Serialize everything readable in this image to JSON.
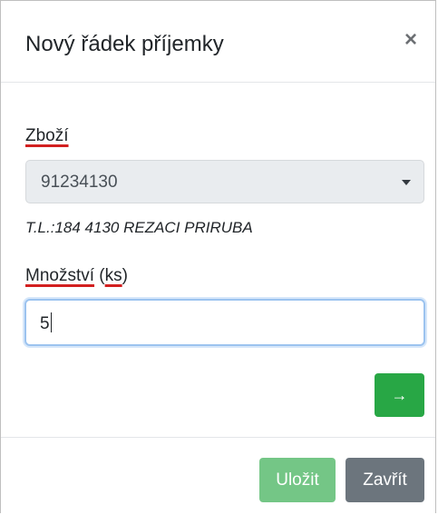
{
  "modal": {
    "title": "Nový řádek příjemky",
    "close_icon": "close-icon",
    "close_glyph": "×"
  },
  "form": {
    "product_label": "Zboží",
    "product_value": "91234130",
    "product_description": "T.L.:184 4130 REZACI PRIRUBA",
    "quantity_label_word": "Množství",
    "quantity_label_unit": "ks",
    "quantity_value": "5",
    "next_glyph": "→",
    "next_icon": "arrow-right-icon"
  },
  "footer": {
    "save_label": "Uložit",
    "close_label": "Zavřít"
  },
  "colors": {
    "success": "#28a745",
    "success_disabled": "#74c686",
    "secondary": "#6c757d",
    "select_bg": "#e9ecef",
    "focus_border": "#9cc3ef",
    "spellcheck_underline": "#d21f1f"
  }
}
